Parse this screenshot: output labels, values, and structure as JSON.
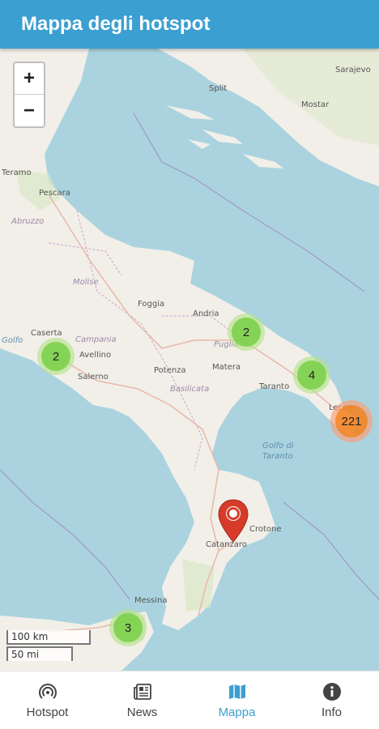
{
  "header": {
    "title": "Mappa degli hotspot"
  },
  "zoom": {
    "in_label": "+",
    "out_label": "−"
  },
  "places": {
    "sarajevo": "Sarajevo",
    "split": "Split",
    "mostar": "Mostar",
    "teramo": "Teramo",
    "pescara": "Pescara",
    "abruzzo": "Abruzzo",
    "molise": "Molise",
    "foggia": "Foggia",
    "andria": "Andria",
    "caserta": "Caserta",
    "campania": "Campania",
    "avellino": "Avellino",
    "salerno": "Salerno",
    "puglia": "Puglia",
    "potenza": "Potenza",
    "matera": "Matera",
    "taranto": "Taranto",
    "basilicata": "Basilicata",
    "lecce": "Lecce",
    "golfo": "Golfo di Taranto",
    "crotone": "Crotone",
    "catanzaro": "Catanzaro",
    "messina": "Messina",
    "golfo_napoli": "Golfo"
  },
  "clusters": [
    {
      "id": "cluster-campania",
      "count": "2",
      "color": "green"
    },
    {
      "id": "cluster-puglia-north",
      "count": "2",
      "color": "green"
    },
    {
      "id": "cluster-brindisi",
      "count": "4",
      "color": "green"
    },
    {
      "id": "cluster-lecce",
      "count": "221",
      "color": "orange"
    },
    {
      "id": "cluster-messina",
      "count": "3",
      "color": "green"
    }
  ],
  "scale": {
    "km": "100 km",
    "mi": "50 mi"
  },
  "tabs": [
    {
      "label": "Hotspot",
      "icon": "hotspot-icon",
      "active": false
    },
    {
      "label": "News",
      "icon": "news-icon",
      "active": false
    },
    {
      "label": "Mappa",
      "icon": "map-icon",
      "active": true
    },
    {
      "label": "Info",
      "icon": "info-icon",
      "active": false
    }
  ],
  "colors": {
    "accent": "#3b9fd1",
    "sea": "#aad3df",
    "land": "#f2efe9",
    "pin": "#d63b2a"
  }
}
